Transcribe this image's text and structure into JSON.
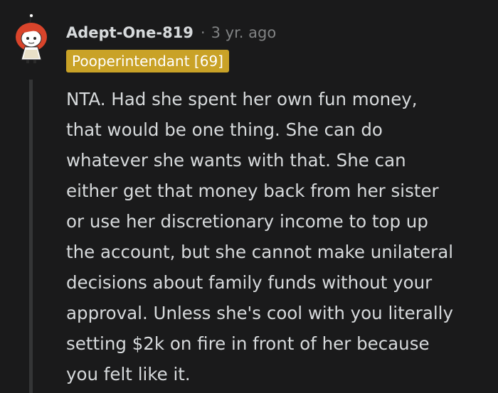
{
  "comment": {
    "author": "Adept-One-819",
    "separator": "·",
    "timestamp": "3 yr. ago",
    "flair": "Pooperintendant [69]",
    "body_lines": [
      "NTA. Had she spent her own fun money,",
      "that would be one thing. She can do",
      "whatever she wants with that. She can",
      "either get that money back from her sister",
      "or use her discretionary income to top up",
      "the account, but she cannot make unilateral",
      "decisions about family funds without your",
      "approval. Unless she's cool with you literally",
      "setting $2k on fire in front of her because",
      "you felt like it."
    ],
    "avatar_icon": "snoo-avatar-icon"
  },
  "colors": {
    "background": "#1a1a1b",
    "text": "#d7dadc",
    "muted": "#818384",
    "flair_bg": "#c9a227",
    "thread_line": "#343536",
    "avatar_hair": "#d9442b"
  }
}
